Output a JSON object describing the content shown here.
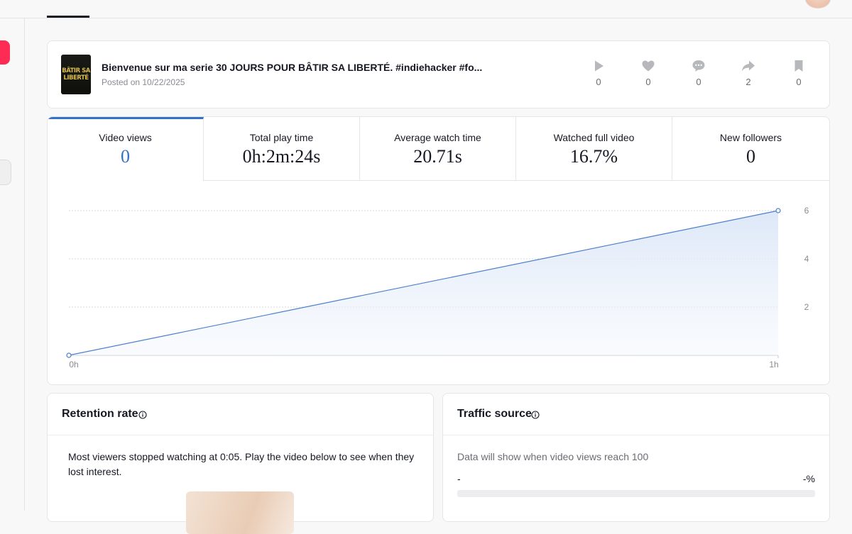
{
  "post": {
    "title": "Bienvenue sur ma serie 30 JOURS POUR BÂTIR SA LIBERTÉ. #indiehacker #fo...",
    "date": "Posted on 10/22/2025",
    "thumbnail_line1": "BÂTIR SA",
    "thumbnail_line2": "LIBERTÉ",
    "stats": [
      {
        "icon": "play-icon",
        "value": "0"
      },
      {
        "icon": "heart-icon",
        "value": "0"
      },
      {
        "icon": "comment-icon",
        "value": "0"
      },
      {
        "icon": "share-icon",
        "value": "2"
      },
      {
        "icon": "bookmark-icon",
        "value": "0"
      }
    ]
  },
  "metrics": [
    {
      "label": "Video views",
      "value": "0"
    },
    {
      "label": "Total play time",
      "value": "0h:2m:24s"
    },
    {
      "label": "Average watch time",
      "value": "20.71s"
    },
    {
      "label": "Watched full video",
      "value": "16.7%"
    },
    {
      "label": "New followers",
      "value": "0"
    }
  ],
  "chart_data": {
    "type": "area",
    "x": [
      "0h",
      "1h"
    ],
    "values": [
      0,
      6
    ],
    "x_tick_labels": [
      "0h",
      "1h"
    ],
    "y_tick_labels": [
      "2",
      "4",
      "6"
    ],
    "ylim": [
      0,
      6
    ],
    "grid": true,
    "y_axis_side": "right",
    "line_color": "#4a7fcb"
  },
  "retention": {
    "title": "Retention rate",
    "text": "Most viewers stopped watching at 0:05. Play the video below to see when they lost interest."
  },
  "traffic": {
    "title": "Traffic source",
    "note": "Data will show when video views reach 100",
    "row_label": "-",
    "row_value": "-%"
  },
  "colors": {
    "accent": "#3370c8",
    "brand": "#fe2c55"
  }
}
